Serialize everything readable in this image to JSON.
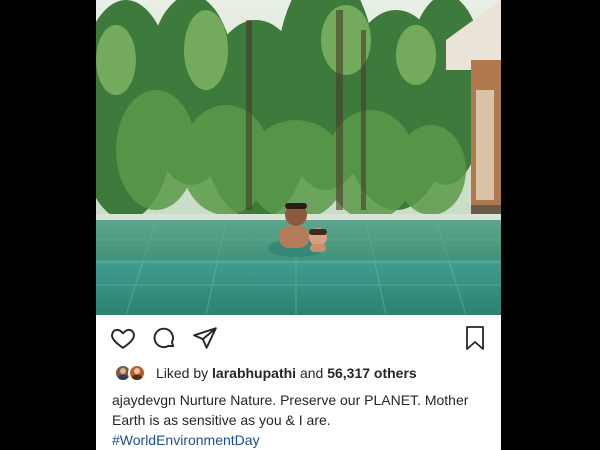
{
  "post": {
    "liked_by_prefix": "Liked by",
    "liked_by_user": "larabhupathi",
    "liked_and": "and",
    "liked_others": "56,317 others",
    "caption_user": "ajaydevgn",
    "caption_text": "Nurture Nature. Preserve our PLANET. Mother Earth is as sensitive as you & I are.",
    "hashtag": "#WorldEnvironmentDay"
  },
  "icons": {
    "like": "heart-icon",
    "comment": "comment-icon",
    "share": "send-icon",
    "save": "bookmark-icon"
  },
  "colors": {
    "text": "#262626",
    "hashtag": "#1d4e8f",
    "background": "#000000"
  }
}
